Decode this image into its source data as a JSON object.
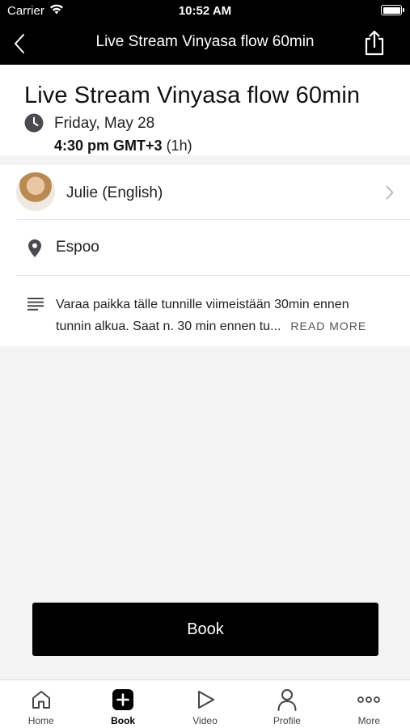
{
  "status_bar": {
    "carrier": "Carrier",
    "time": "10:52 AM"
  },
  "nav": {
    "title": "Live Stream Vinyasa flow 60min",
    "back_icon": "chevron-left-icon",
    "share_icon": "share-icon"
  },
  "class_header": {
    "title": "Live Stream Vinyasa flow 60min",
    "date": "Friday, May 28",
    "time": "4:30 pm GMT+3",
    "duration": "(1h)"
  },
  "instructor": {
    "name": "Julie (English)"
  },
  "location": {
    "name": "Espoo"
  },
  "description": {
    "line1": "Varaa paikka tälle tunnille viimeistään 30min ennen",
    "line2": "tunnin alkua. Saat n. 30 min ennen tu...",
    "read_more": "READ MORE"
  },
  "book_button": {
    "label": "Book"
  },
  "tab_bar": {
    "active": "Book",
    "items": [
      {
        "label": "Home",
        "icon": "home-icon"
      },
      {
        "label": "Book",
        "icon": "plus-square-icon"
      },
      {
        "label": "Video",
        "icon": "play-icon"
      },
      {
        "label": "Profile",
        "icon": "person-icon"
      },
      {
        "label": "More",
        "icon": "more-dots-icon"
      }
    ]
  },
  "colors": {
    "header_background": "#000000",
    "book_button": "#000000",
    "page_background": "#f3f3f4"
  }
}
